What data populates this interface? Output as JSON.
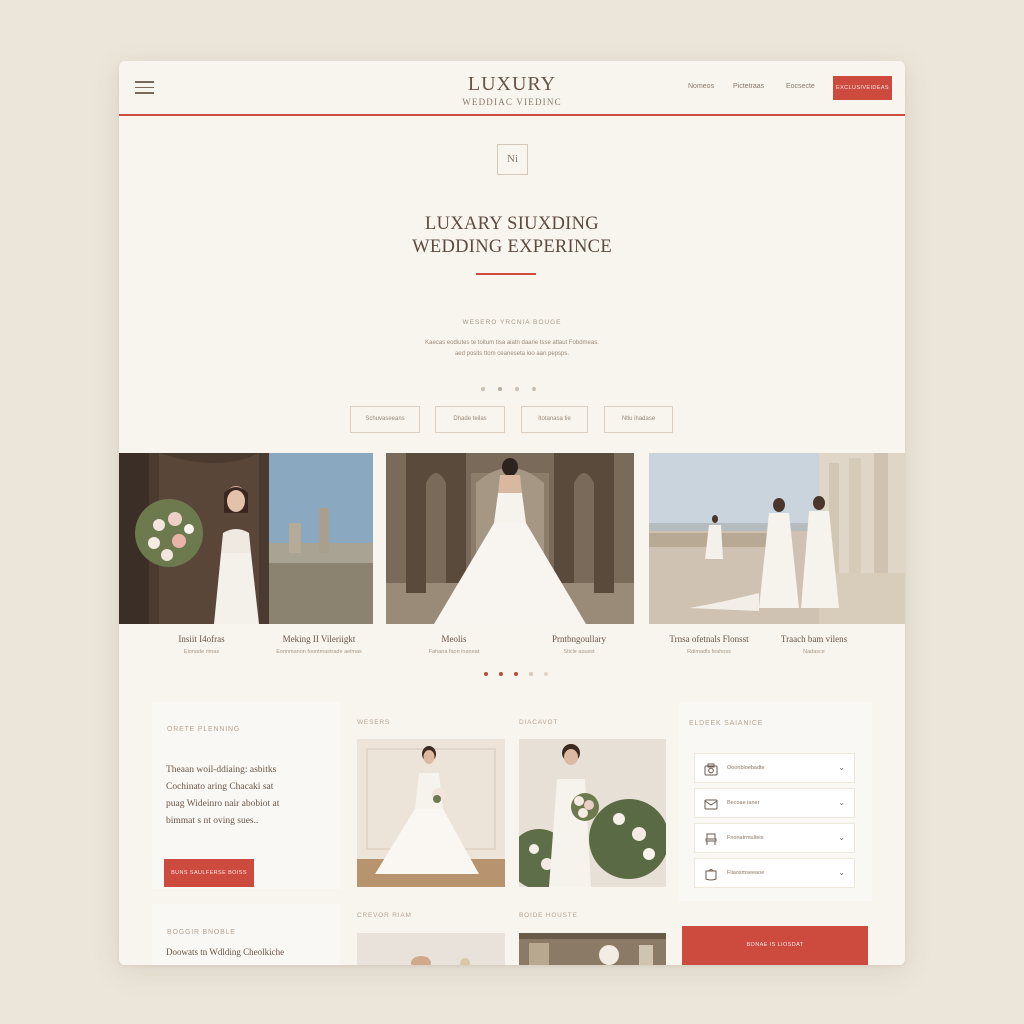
{
  "header": {
    "brand_title": "LUXURY",
    "brand_subtitle": "WEDDIAC VIEDINC",
    "nav": [
      "Nomeos",
      "Pictetraas",
      "Eocsecte"
    ],
    "cta": "EXCLUSIVEIDEAS"
  },
  "hero": {
    "monogram": "Ni",
    "title_line1": "LUXARY SIUXDING",
    "title_line2": "WEDDING EXPERINCE",
    "kicker": "WESERO  YRCNIA BOUGE",
    "desc_line1": "Kaecas eodiutes te toltum tisa aiatn daarie tsse atlaut Fobdmeas.",
    "desc_line2": "aed posits ttom ceaneseta ioo aan pepsps."
  },
  "filters": [
    "Schuvaseeans",
    "Dhade teilas",
    "Itotanasa tie",
    "Ntlu ihadase"
  ],
  "gallery": [
    {
      "title": "Insiit I4ofras",
      "subtitle": "Eionade rimas"
    },
    {
      "title": "Meking II Vileriigkt",
      "subtitle": "Eonnmanon foontmastrade aelmas"
    },
    {
      "title": "Meolis",
      "subtitle": "Fahana faon inaneat"
    },
    {
      "title": "Prntbngoullary",
      "subtitle": "Sticle aousst"
    },
    {
      "title": "Trnsa ofetnals Flonsst",
      "subtitle": "Rdimadls feahoss"
    },
    {
      "title": "Traach bam vilens",
      "subtitle": "Nadasce"
    }
  ],
  "planning": {
    "kicker": "ORETE PLENNING",
    "body": [
      "Theaan woil-ddiaing: asbitks",
      "Cochinato aring Chacaki sat",
      "puag Wideinro nair abobiot at",
      "bimmat s nt oving sues.."
    ],
    "button": "BUNS SAULFERSE BOISS"
  },
  "bottom_card": {
    "kicker": "BOGGIR BNOBLE",
    "body": "Doowats tn Wdlding Cheolkiche"
  },
  "photos": {
    "label1": "WESERS",
    "label2": "DIACAVOT",
    "label3": "CREVOR RIAM",
    "label4": "BOIDE HOUSTE"
  },
  "guidance": {
    "kicker": "ELDEEK SAIANICE",
    "items": [
      {
        "icon": "camera-icon",
        "label": "Ooonbloebadte"
      },
      {
        "icon": "envelope-icon",
        "label": "Becoae ianer"
      },
      {
        "icon": "chair-icon",
        "label": "Fnonatrmulteis"
      },
      {
        "icon": "bag-icon",
        "label": "Fiiaosmseeaoe"
      }
    ],
    "button": "BONAE IS LIOSDAT"
  },
  "colors": {
    "accent": "#cc4a3e",
    "background": "#f8f5ef",
    "text": "#6a5445"
  }
}
